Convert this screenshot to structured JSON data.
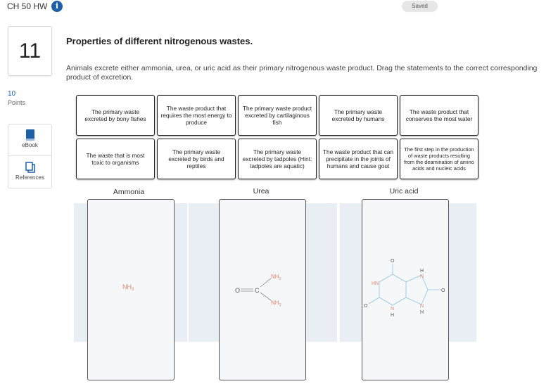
{
  "header": {
    "title": "CH 50 HW",
    "info_icon": "info-icon",
    "status": "Saved"
  },
  "question": {
    "number": "11",
    "points_value": "10",
    "points_label": "Points",
    "title": "Properties of different nitrogenous wastes.",
    "instructions": "Animals excrete either ammonia, urea, or uric acid as their primary nitrogenous waste product. Drag the statements to the correct corresponding product of excretion."
  },
  "sidebar": {
    "ebook_label": "eBook",
    "references_label": "References"
  },
  "cards": [
    "The primary waste excreted by bony fishes",
    "The waste product that requires the most energy to produce",
    "The primary waste product excreted by cartilaginous fish",
    "The primary waste excreted by humans",
    "The waste product that conserves the most water",
    "The waste that is most toxic to organisms",
    "The primary waste excreted by birds and reptiles",
    "The primary waste excreted by tadpoles (Hint: tadpoles are aquatic)",
    "The waste product that can precipitate in the joints of humans and cause gout",
    "The first step in the production of waste products resulting from the deamination of amino acids and nucleic acids"
  ],
  "zones": [
    {
      "label": "Ammonia",
      "formula": "NH3"
    },
    {
      "label": "Urea",
      "formula": "O=C(NH2)2"
    },
    {
      "label": "Uric acid",
      "formula": "C5H4N4O3"
    }
  ],
  "colors": {
    "accent": "#1f5fa8",
    "atom_red": "#e0876e",
    "atom_blue": "#6a9fd4",
    "zone_bg": "#e8eef4"
  }
}
